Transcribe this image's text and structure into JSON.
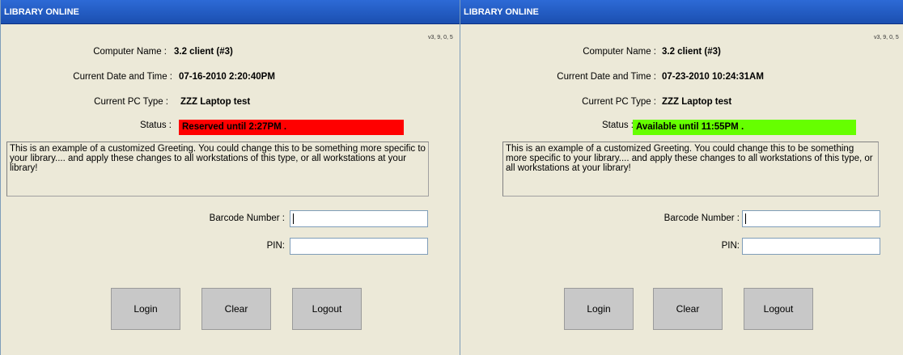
{
  "panels": [
    {
      "title": "LIBRARY ONLINE",
      "version": "v3, 9, 0, 5",
      "computer_name_label": "Computer Name :",
      "computer_name": "3.2 client (#3)",
      "datetime_label": "Current Date and Time :",
      "datetime": "07-16-2010 2:20:40PM",
      "pc_type_label": "Current PC Type :",
      "pc_type": "ZZZ Laptop test",
      "status_label": "Status :",
      "status": "Reserved until 2:27PM .",
      "status_color": "#ff0000",
      "greeting": "This is an example of a customized Greeting.  You could change this to be something more specific to your library.... and apply these changes to all workstations of this type, or all workstations at your library!",
      "barcode_label": "Barcode Number :",
      "barcode_value": "",
      "pin_label": "PIN:",
      "pin_value": "",
      "login_label": "Login",
      "clear_label": "Clear",
      "logout_label": "Logout"
    },
    {
      "title": "LIBRARY ONLINE",
      "version": "v3, 9, 0, 5",
      "computer_name_label": "Computer Name :",
      "computer_name": "3.2 client (#3)",
      "datetime_label": "Current Date and Time :",
      "datetime": "07-23-2010 10:24:31AM",
      "pc_type_label": "Current PC Type :",
      "pc_type": "ZZZ Laptop test",
      "status_label": "Status :",
      "status": "Available until 11:55PM .",
      "status_color": "#66ff00",
      "greeting": "This is an example of a customized Greeting.  You could change this to be something more specific to your library.... and apply these changes to all workstations of this type, or all workstations at your library!",
      "barcode_label": "Barcode Number :",
      "barcode_value": "",
      "pin_label": "PIN:",
      "pin_value": "",
      "login_label": "Login",
      "clear_label": "Clear",
      "logout_label": "Logout"
    }
  ]
}
